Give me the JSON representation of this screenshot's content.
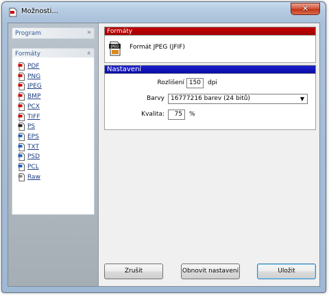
{
  "window": {
    "title": "Možnosti..."
  },
  "sidebar": {
    "program_label": "Program",
    "formaty_label": "Formáty",
    "items": [
      {
        "label": "PDF",
        "color": "#cc0000"
      },
      {
        "label": "PNG",
        "color": "#cc0000"
      },
      {
        "label": "JPEG",
        "color": "#cc0000"
      },
      {
        "label": "BMP",
        "color": "#cc0000"
      },
      {
        "label": "PCX",
        "color": "#cc0000"
      },
      {
        "label": "TIFF",
        "color": "#cc0000"
      },
      {
        "label": "PS",
        "color": "#222222"
      },
      {
        "label": "EPS",
        "color": "#1e5fb4"
      },
      {
        "label": "TXT",
        "color": "#1e5fb4"
      },
      {
        "label": "PSD",
        "color": "#1e5fb4"
      },
      {
        "label": "PCL",
        "color": "#1e5fb4"
      },
      {
        "label": "Raw",
        "color": "#888888"
      }
    ]
  },
  "formaty_panel": {
    "header": "Formáty",
    "icon_text": "JPEG",
    "format_name": "Formát JPEG (JFIF)"
  },
  "nastaveni_panel": {
    "header": "Nastavení",
    "resolution_label": "Rozlišení",
    "resolution_value": "150",
    "resolution_unit": "dpi",
    "colors_label": "Barvy",
    "colors_value": "16777216 barev (24 bitů)",
    "quality_label": "Kvalita:",
    "quality_value": "75",
    "quality_unit": "%"
  },
  "buttons": {
    "cancel": "Zrušit",
    "reset": "Obnovit nastavení",
    "save": "Uložit"
  }
}
